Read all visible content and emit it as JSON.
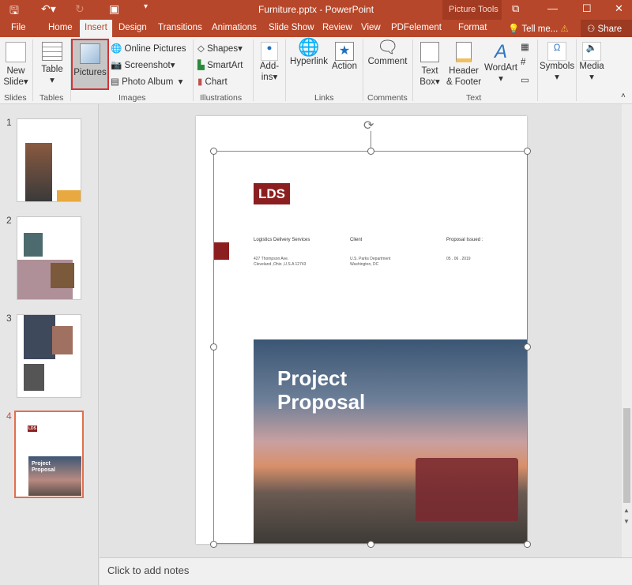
{
  "window": {
    "title": "Furniture.pptx - PowerPoint",
    "context_tab_group": "Picture Tools"
  },
  "tabs": [
    "File",
    "Home",
    "Insert",
    "Design",
    "Transitions",
    "Animations",
    "Slide Show",
    "Review",
    "View",
    "PDFelement",
    "Format"
  ],
  "active_tab": "Insert",
  "tell_me": "Tell me...",
  "share": "Share",
  "ribbon": {
    "slides": {
      "new_slide": "New Slide",
      "label": "Slides"
    },
    "tables": {
      "table": "Table",
      "label": "Tables"
    },
    "images": {
      "pictures": "Pictures",
      "online_pictures": "Online Pictures",
      "screenshot": "Screenshot",
      "photo_album": "Photo Album",
      "label": "Images"
    },
    "illustrations": {
      "shapes": "Shapes",
      "smartart": "SmartArt",
      "chart": "Chart",
      "label": "Illustrations"
    },
    "addins": {
      "addins": "Add-ins"
    },
    "links": {
      "hyperlink": "Hyperlink",
      "action": "Action",
      "label": "Links"
    },
    "comments": {
      "comment": "Comment",
      "label": "Comments"
    },
    "text": {
      "text_box": "Text Box",
      "header_footer": "Header & Footer",
      "wordart": "WordArt",
      "label": "Text"
    },
    "symbols": {
      "symbols": "Symbols"
    },
    "media": {
      "media": "Media"
    }
  },
  "thumbnails": [
    "1",
    "2",
    "3",
    "4"
  ],
  "selected_slide": "4",
  "slide": {
    "logo": "LDS",
    "company": "Logistics Delivery Services",
    "address1": "427 Thompson Ave.",
    "address2": "Cleveland ,Ohio ,U.S.A 12743",
    "client_label": "Client",
    "client1": "U.S. Parks Department",
    "client2": "Washington, DC",
    "issued_label": "Proposal Issued :",
    "issued_date": "05 . 06 . 2019",
    "title1": "Project",
    "title2": "Proposal"
  },
  "thumb4": {
    "logo": "LDS",
    "title": "Project Proposal"
  },
  "notes_placeholder": "Click to add notes",
  "colors": {
    "accent": "#b7472a",
    "brand": "#8b1f1f",
    "selection": "#d13438"
  }
}
